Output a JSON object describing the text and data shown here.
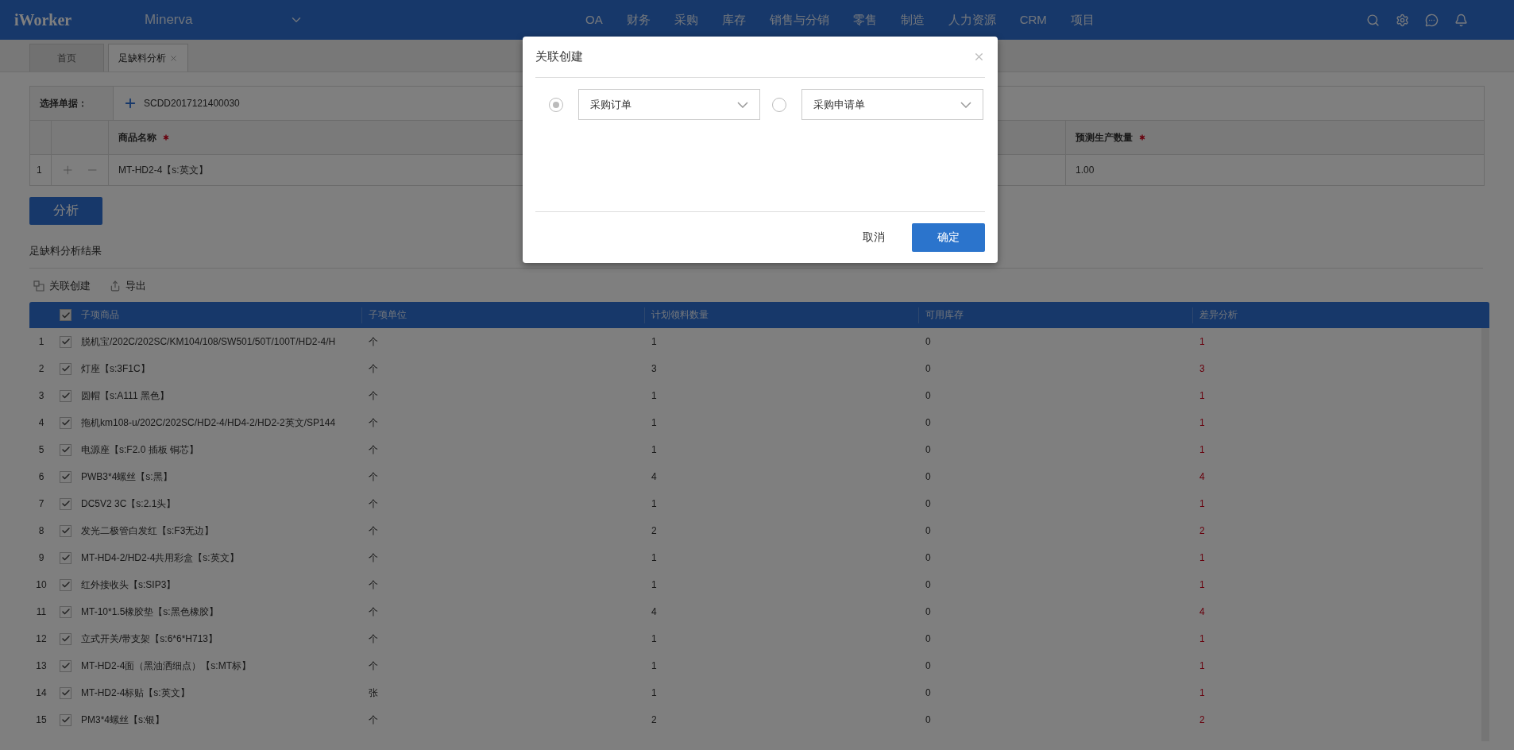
{
  "header": {
    "logo": "iWorker",
    "company": "Minerva",
    "nav": [
      "OA",
      "财务",
      "采购",
      "库存",
      "销售与分销",
      "零售",
      "制造",
      "人力资源",
      "CRM",
      "项目"
    ]
  },
  "tabs": [
    {
      "label": "首页",
      "selected": false,
      "closable": false
    },
    {
      "label": "足缺料分析",
      "selected": true,
      "closable": true
    }
  ],
  "form": {
    "select_label": "选择单据：",
    "document": "SCDD2017121400030",
    "columns": [
      {
        "label": "商品名称",
        "required": true
      },
      {
        "label": "预测生产数量",
        "required": true
      }
    ],
    "rows": [
      {
        "index": "1",
        "product": "MT-HD2-4【s:英文】",
        "quantity": "1.00"
      }
    ]
  },
  "analyze_button": "分析",
  "results": {
    "title": "足缺料分析结果",
    "actions": [
      {
        "label": "关联创建",
        "kind": "link"
      },
      {
        "label": "导出",
        "kind": "export"
      }
    ],
    "header_checked": true,
    "columns": [
      "子项商品",
      "子项单位",
      "计划领料数量",
      "可用库存",
      "差异分析"
    ],
    "rows": [
      {
        "index": "1",
        "checked": true,
        "cells": [
          "脱机宝/202C/202SC/KM104/108/SW501/50T/100T/HD2-4/H",
          "个",
          "1",
          "0",
          "1"
        ]
      },
      {
        "index": "2",
        "checked": true,
        "cells": [
          "灯座【s:3F1C】",
          "个",
          "3",
          "0",
          "3"
        ]
      },
      {
        "index": "3",
        "checked": true,
        "cells": [
          "圆帽【s:A111 黑色】",
          "个",
          "1",
          "0",
          "1"
        ]
      },
      {
        "index": "4",
        "checked": true,
        "cells": [
          "拖机km108-u/202C/202SC/HD2-4/HD4-2/HD2-2英文/SP144",
          "个",
          "1",
          "0",
          "1"
        ]
      },
      {
        "index": "5",
        "checked": true,
        "cells": [
          "电源座【s:F2.0 插板 铜芯】",
          "个",
          "1",
          "0",
          "1"
        ]
      },
      {
        "index": "6",
        "checked": true,
        "cells": [
          "PWB3*4螺丝【s:黑】",
          "个",
          "4",
          "0",
          "4"
        ]
      },
      {
        "index": "7",
        "checked": true,
        "cells": [
          "DC5V2 3C【s:2.1头】",
          "个",
          "1",
          "0",
          "1"
        ]
      },
      {
        "index": "8",
        "checked": true,
        "cells": [
          "发光二极管白发红【s:F3无边】",
          "个",
          "2",
          "0",
          "2"
        ]
      },
      {
        "index": "9",
        "checked": true,
        "cells": [
          "MT-HD4-2/HD2-4共用彩盒【s:英文】",
          "个",
          "1",
          "0",
          "1"
        ]
      },
      {
        "index": "10",
        "checked": true,
        "cells": [
          "红外接收头【s:SIP3】",
          "个",
          "1",
          "0",
          "1"
        ]
      },
      {
        "index": "11",
        "checked": true,
        "cells": [
          "MT-10*1.5橡胶垫【s:黑色橡胶】",
          "个",
          "4",
          "0",
          "4"
        ]
      },
      {
        "index": "12",
        "checked": true,
        "cells": [
          "立式开关/带支架【s:6*6*H713】",
          "个",
          "1",
          "0",
          "1"
        ]
      },
      {
        "index": "13",
        "checked": true,
        "cells": [
          "MT-HD2-4面（黑油洒细点）【s:MT标】",
          "个",
          "1",
          "0",
          "1"
        ]
      },
      {
        "index": "14",
        "checked": true,
        "cells": [
          "MT-HD2-4标贴【s:英文】",
          "张",
          "1",
          "0",
          "1"
        ]
      },
      {
        "index": "15",
        "checked": true,
        "cells": [
          "PM3*4螺丝【s:银】",
          "个",
          "2",
          "0",
          "2"
        ]
      }
    ]
  },
  "modal": {
    "title": "关联创建",
    "options": [
      {
        "label": "采购订单",
        "selected": true
      },
      {
        "label": "采购申请单",
        "selected": false
      }
    ],
    "buttons": [
      {
        "label": "取消",
        "kind": "secondary"
      },
      {
        "label": "确定",
        "kind": "primary"
      }
    ]
  }
}
